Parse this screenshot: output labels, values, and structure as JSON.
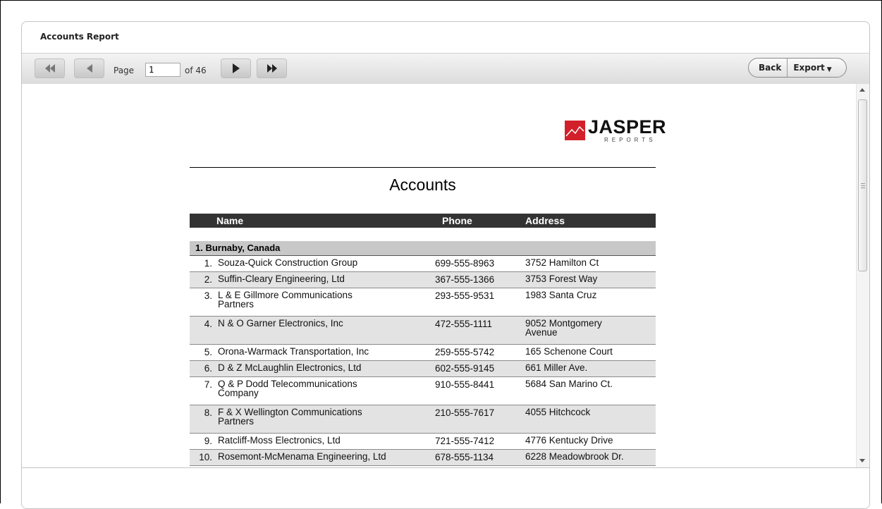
{
  "window": {
    "title": "Accounts Report"
  },
  "toolbar": {
    "page_label": "Page",
    "page_value": "1",
    "of_label": "of 46",
    "back_label": "Back",
    "export_label": "Export"
  },
  "report": {
    "logo_text": "JASPER",
    "logo_sub": "REPORTS",
    "title": "Accounts",
    "columns": {
      "name": "Name",
      "phone": "Phone",
      "address": "Address"
    },
    "group": "1. Burnaby, Canada",
    "rows": [
      {
        "num": "1.",
        "name": "Souza-Quick Construction Group",
        "phone": "699-555-8963",
        "address": "3752 Hamilton Ct"
      },
      {
        "num": "2.",
        "name": "Suffin-Cleary Engineering, Ltd",
        "phone": "367-555-1366",
        "address": "3753 Forest Way"
      },
      {
        "num": "3.",
        "name": "L & E Gillmore Communications Partners",
        "phone": "293-555-9531",
        "address": "1983 Santa Cruz"
      },
      {
        "num": "4.",
        "name": "N & O Garner Electronics, Inc",
        "phone": "472-555-1111",
        "address": "9052 Montgomery Avenue"
      },
      {
        "num": "5.",
        "name": "Orona-Warmack Transportation, Inc",
        "phone": "259-555-5742",
        "address": "165 Schenone Court"
      },
      {
        "num": "6.",
        "name": "D & Z McLaughlin Electronics, Ltd",
        "phone": "602-555-9145",
        "address": "661 Miller Ave."
      },
      {
        "num": "7.",
        "name": "Q & P Dodd Telecommunications Company",
        "phone": "910-555-8441",
        "address": "5684 San Marino Ct."
      },
      {
        "num": "8.",
        "name": "F & X Wellington Communications Partners",
        "phone": "210-555-7617",
        "address": "4055 Hitchcock"
      },
      {
        "num": "9.",
        "name": "Ratcliff-Moss Electronics, Ltd",
        "phone": "721-555-7412",
        "address": "4776 Kentucky Drive"
      },
      {
        "num": "10.",
        "name": "Rosemont-McMenama Engineering, Ltd",
        "phone": "678-555-1134",
        "address": "6228 Meadowbrook Dr."
      }
    ]
  }
}
